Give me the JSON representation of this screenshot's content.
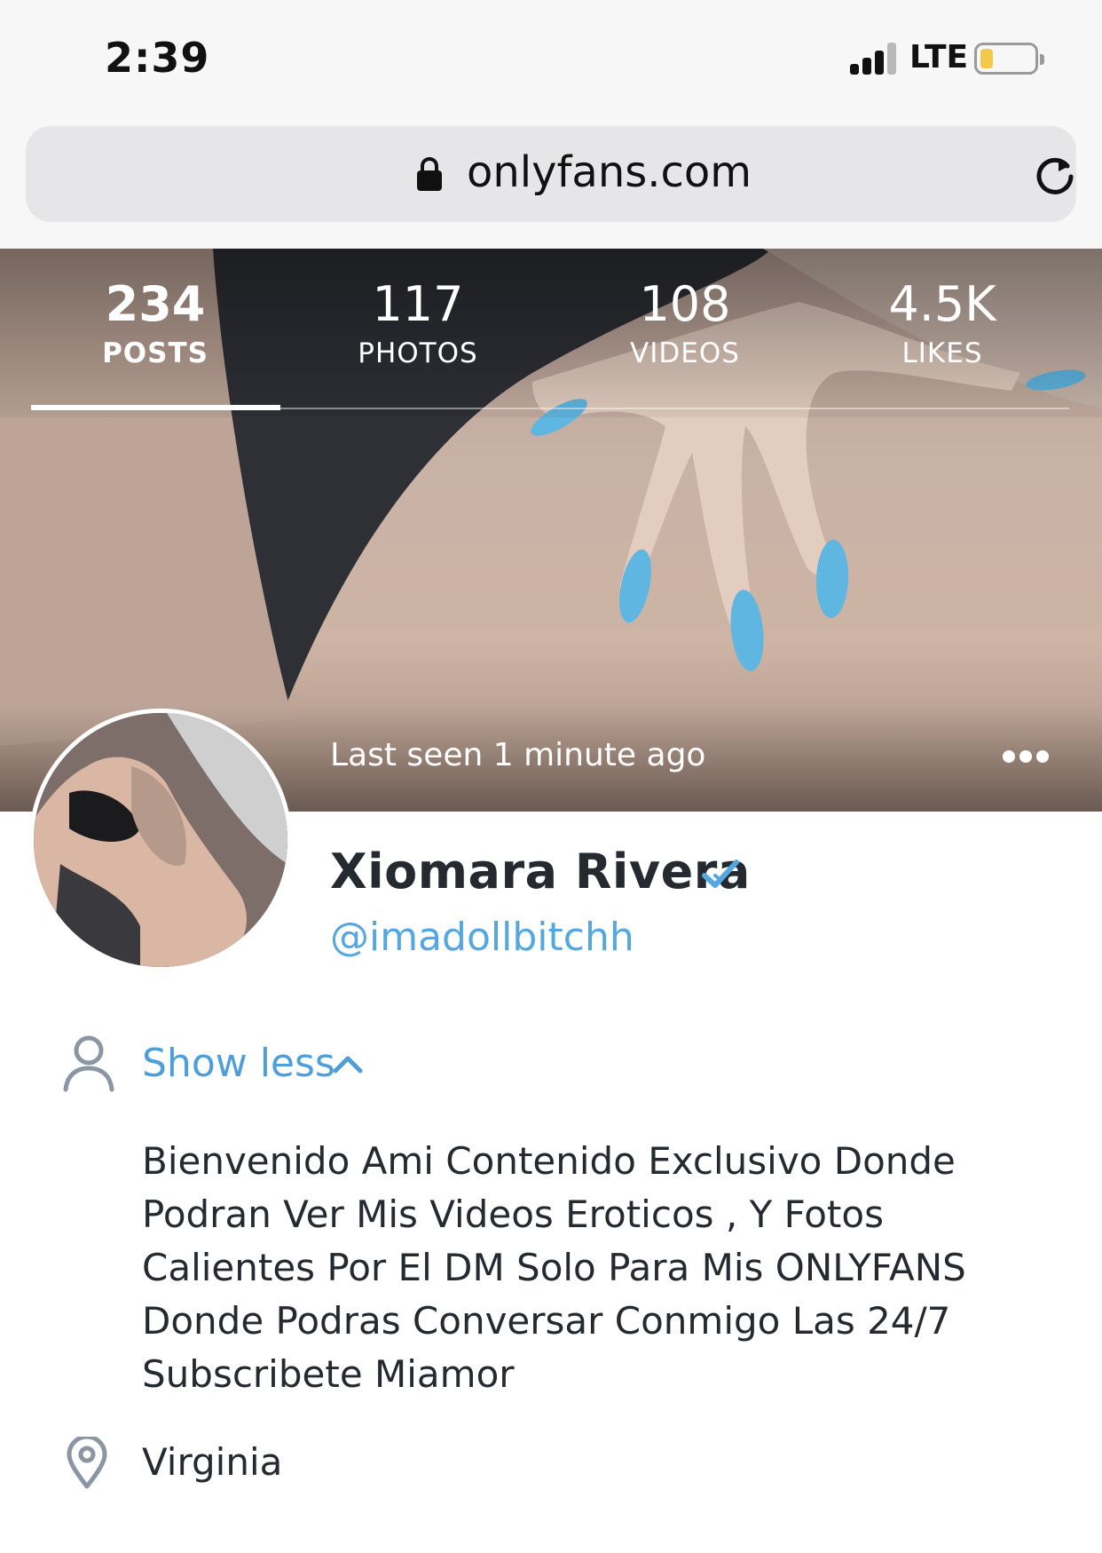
{
  "status_bar": {
    "time": "2:39",
    "network": "LTE"
  },
  "browser": {
    "url": "onlyfans.com"
  },
  "profile": {
    "stats": [
      {
        "value": "234",
        "label": "POSTS"
      },
      {
        "value": "117",
        "label": "PHOTOS"
      },
      {
        "value": "108",
        "label": "VIDEOS"
      },
      {
        "value": "4.5K",
        "label": "LIKES"
      }
    ],
    "last_seen": "Last seen 1 minute ago",
    "name": "Xiomara Rivera",
    "handle": "@imadollbitchh",
    "toggle_label": "Show less",
    "bio_lines": [
      "Bienvenido Ami Contenido Exclusivo Donde",
      "Podran Ver Mis Videos Eroticos , Y Fotos",
      "Calientes Por El DM Solo Para Mis ONLYFANS",
      "Donde Podras Conversar Conmigo Las 24/7",
      "Subscribete Miamor"
    ],
    "location": "Virginia"
  },
  "colors": {
    "accent": "#54a7e0",
    "text": "#242a30",
    "browser_bg": "#f7f7f7"
  },
  "icons": [
    "cellular-signal-icon",
    "battery-icon",
    "lock-icon",
    "reload-icon",
    "more-dots-icon",
    "verified-check-icon",
    "user-icon",
    "chevron-up-icon",
    "location-pin-icon"
  ]
}
